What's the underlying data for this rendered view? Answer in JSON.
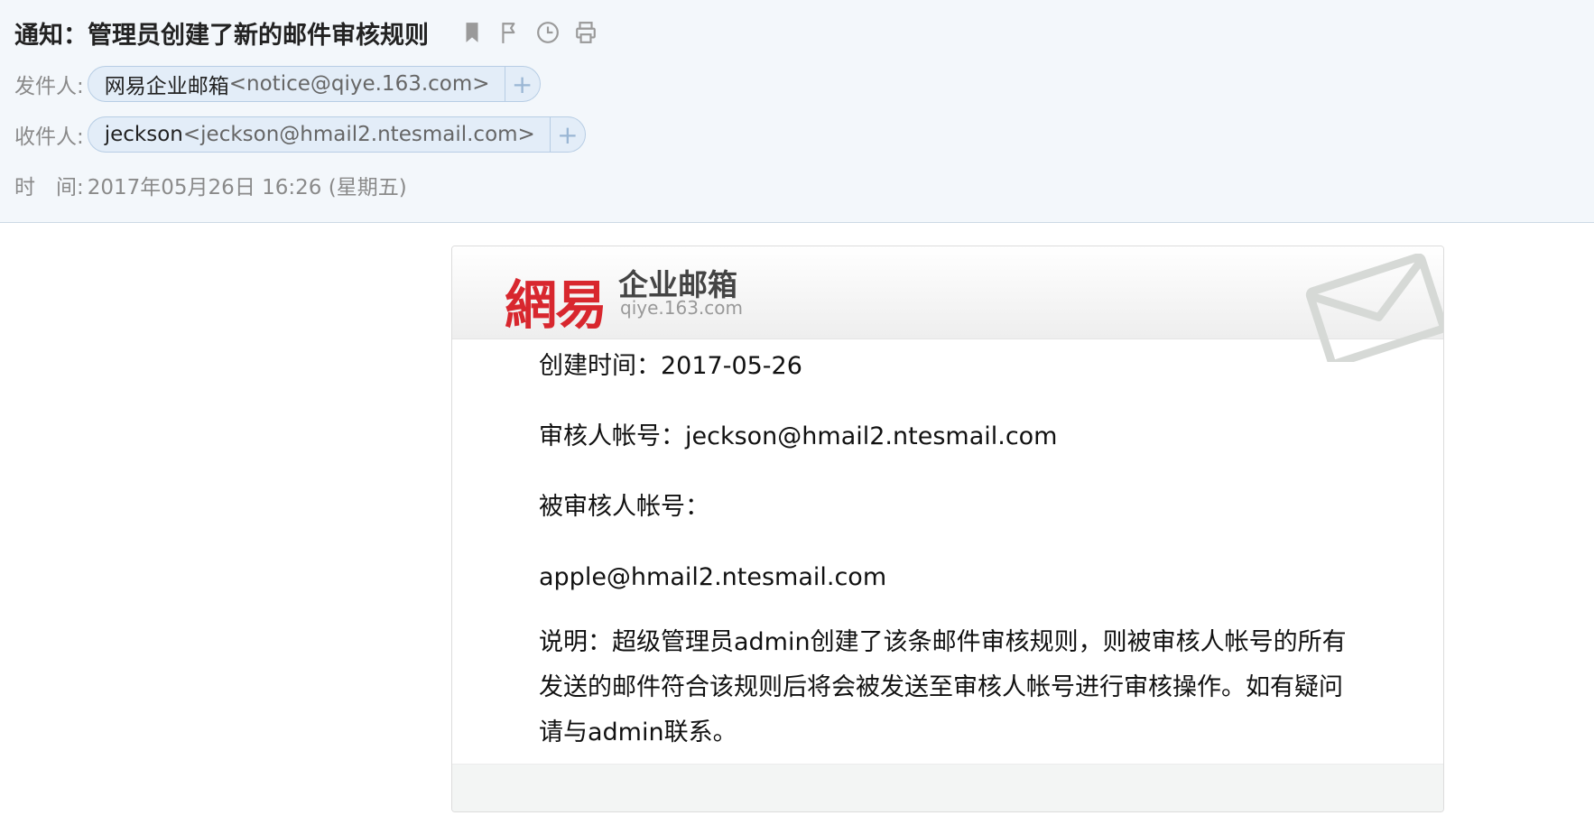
{
  "header": {
    "subject": "通知：管理员创建了新的邮件审核规则",
    "sender_label": "发件人:",
    "sender": {
      "name": "网易企业邮箱",
      "address": "<notice@qiye.163.com>",
      "add": "+"
    },
    "recipient_label": "收件人:",
    "recipient": {
      "name": "jeckson",
      "address": "<jeckson@hmail2.ntesmail.com>",
      "add": "+"
    },
    "time_label": "时　间:",
    "time_value": "2017年05月26日 16:26 (星期五)"
  },
  "card": {
    "logo_mark": "網易",
    "logo_text": "企业邮箱",
    "logo_domain": "qiye.163.com",
    "created": "创建时间：2017-05-26",
    "reviewer": "审核人帐号：jeckson@hmail2.ntesmail.com",
    "reviewee_label": "被审核人帐号：",
    "reviewee": "apple@hmail2.ntesmail.com",
    "description": "说明：超级管理员admin创建了该条邮件审核规则，则被审核人帐号的所有发送的邮件符合该规则后将会被发送至审核人帐号进行审核操作。如有疑问请与admin联系。"
  },
  "icons": [
    "bookmark-icon",
    "flag-icon",
    "clock-icon",
    "print-icon"
  ],
  "colors": {
    "brand_red": "#d8272e",
    "chip_bg": "#e3edf8",
    "header_bg": "#f3f7fb"
  }
}
